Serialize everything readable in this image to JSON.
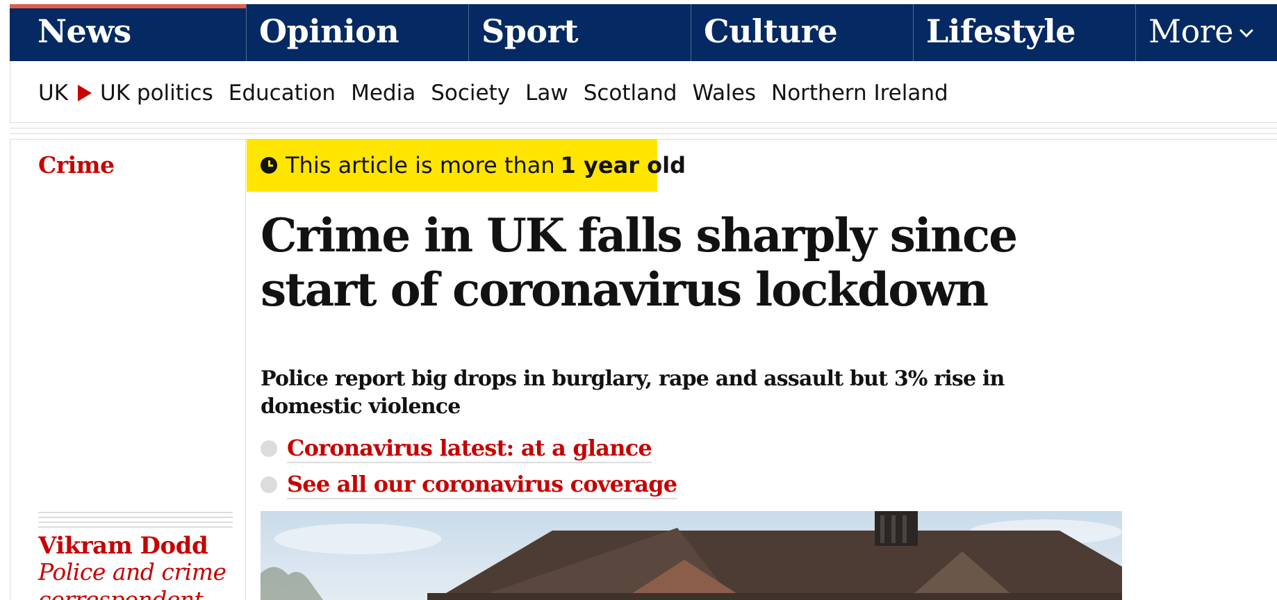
{
  "nav": {
    "pillars": [
      "News",
      "Opinion",
      "Sport",
      "Culture",
      "Lifestyle"
    ],
    "more_label": "More",
    "active_color": "#e05e4b",
    "bar_color": "#052962"
  },
  "subnav": {
    "items": [
      "UK",
      "UK politics",
      "Education",
      "Media",
      "Society",
      "Law",
      "Scotland",
      "Wales",
      "Northern Ireland"
    ]
  },
  "article": {
    "section": "Crime",
    "age_notice_prefix": "This article is more than",
    "age_notice_bold": "1 year old",
    "headline": "Crime in UK falls sharply since start of coronavirus lockdown",
    "standfirst": "Police report big drops in burglary, rape and assault but 3% rise in domestic violence",
    "links": [
      "Coronavirus latest: at a glance",
      "See all our coronavirus coverage"
    ],
    "author": "Vikram Dodd",
    "author_role": "Police and crime correspondent",
    "accent_color": "#c70000",
    "badge_color": "#ffe500"
  },
  "icons": {
    "clock": "clock-icon",
    "chevron": "chevron-down-icon",
    "bullet": "bullet-dot-icon"
  }
}
